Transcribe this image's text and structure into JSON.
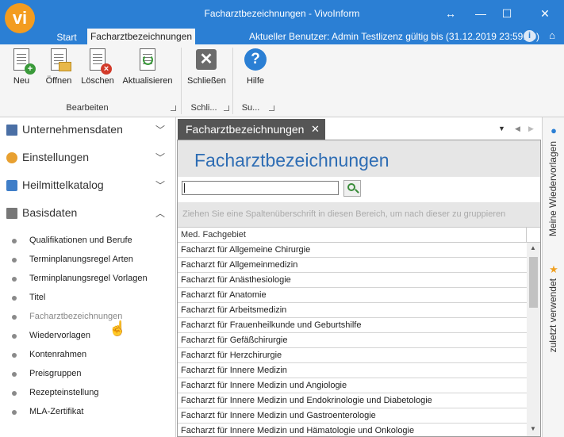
{
  "window": {
    "title": "Facharztbezeichnungen - VivoInform",
    "logo_text": "vi",
    "controls": {
      "restore": "↔",
      "minimize": "—",
      "maximize": "☐",
      "close": "✕"
    }
  },
  "tabs": {
    "start": "Start",
    "active": "Facharztbezeichnungen"
  },
  "user_info": "Aktueller Benutzer: Admin Testlizenz gültig bis (31.12.2019 23:59:00)",
  "ribbon": {
    "buttons": {
      "new": "Neu",
      "open": "Öffnen",
      "delete": "Löschen",
      "refresh": "Aktualisieren",
      "close": "Schließen",
      "help": "Hilfe"
    },
    "groups": {
      "edit": "Bearbeiten",
      "close": "Schli...",
      "help": "Su..."
    }
  },
  "nav": {
    "groups": [
      "Unternehmensdaten",
      "Einstellungen",
      "Heilmittelkatalog",
      "Basisdaten"
    ],
    "items": [
      "Qualifikationen und Berufe",
      "Terminplanungsregel Arten",
      "Terminplanungsregel Vorlagen",
      "Titel",
      "Facharztbezeichnungen",
      "Wiedervorlagen",
      "Kontenrahmen",
      "Preisgruppen",
      "Rezepteinstellung",
      "MLA-Zertifikat"
    ]
  },
  "doc_tab": {
    "label": "Facharztbezeichnungen",
    "close": "✕"
  },
  "content": {
    "title": "Facharztbezeichnungen",
    "search_value": "",
    "group_hint": "Ziehen Sie eine Spaltenüberschrift in diesen Bereich, um nach dieser zu gruppieren",
    "column_header": "Med. Fachgebiet",
    "rows": [
      "Facharzt für Allgemeine Chirurgie",
      "Facharzt für Allgemeinmedizin",
      "Facharzt für Anästhesiologie",
      "Facharzt für Anatomie",
      "Facharzt für Arbeitsmedizin",
      "Facharzt für Frauenheilkunde und Geburtshilfe",
      "Facharzt für Gefäßchirurgie",
      "Facharzt für Herzchirurgie",
      "Facharzt für Innere Medizin",
      "Facharzt für Innere Medizin und Angiologie",
      "Facharzt für Innere Medizin und Endokrinologie und Diabetologie",
      "Facharzt für Innere Medizin und Gastroenterologie",
      "Facharzt für Innere Medizin und Hämatologie und Onkologie"
    ]
  },
  "side_panel": {
    "wiedervorlagen": "Meine Wiedervorlagen",
    "recent": "zuletzt verwendet"
  },
  "colors": {
    "accent": "#2b7fd4",
    "logo": "#f39c1f",
    "title_blue": "#2e6db4"
  }
}
